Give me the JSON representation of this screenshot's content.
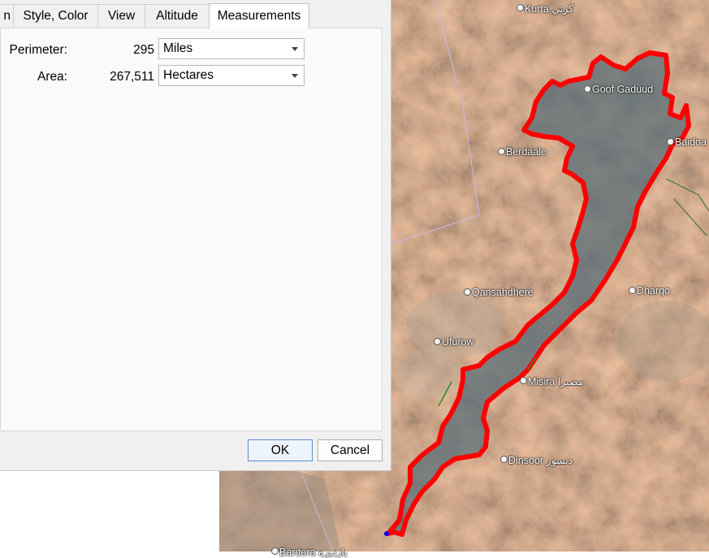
{
  "tabs": [
    {
      "label": "n"
    },
    {
      "label": "Style, Color"
    },
    {
      "label": "View"
    },
    {
      "label": "Altitude"
    },
    {
      "label": "Measurements"
    }
  ],
  "measurements": {
    "perimeter": {
      "label": "Perimeter:",
      "value": "295",
      "unit": "Miles"
    },
    "area": {
      "label": "Area:",
      "value": "267,511",
      "unit": "Hectares"
    }
  },
  "buttons": {
    "ok": "OK",
    "cancel": "Cancel"
  },
  "map": {
    "places": [
      {
        "name": "Kurta كرتي"
      },
      {
        "name": "Goof Gaduud"
      },
      {
        "name": "Baidoa"
      },
      {
        "name": "Berdaale"
      },
      {
        "name": "Qansahdhere"
      },
      {
        "name": "Dharqo"
      },
      {
        "name": "Ufurow"
      },
      {
        "name": "Misira مصيرا"
      },
      {
        "name": "Dinsoor دنسور"
      },
      {
        "name": "Bardera بارديره"
      }
    ],
    "polygon_color": "#ff0000",
    "boundary_color": "#c8b6d8"
  }
}
